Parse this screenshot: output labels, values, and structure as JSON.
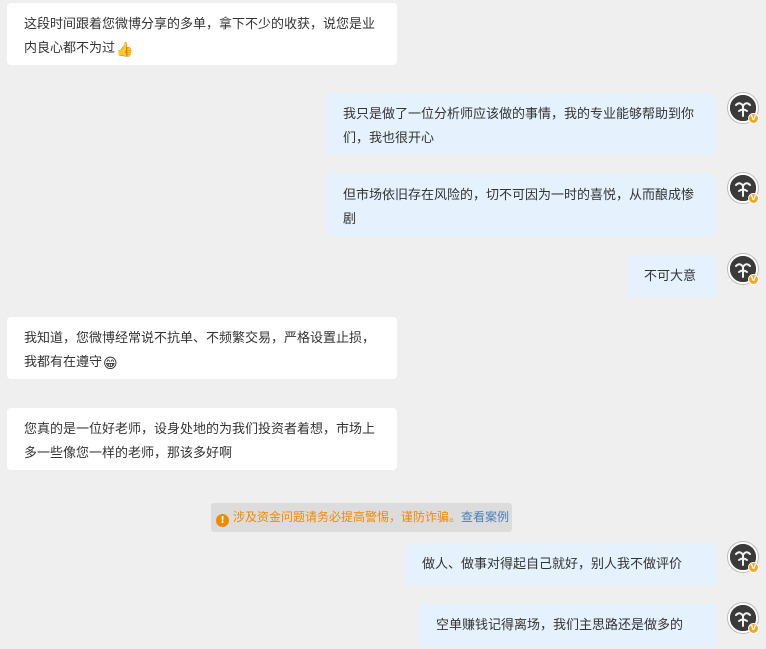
{
  "messages": [
    {
      "side": "incoming",
      "text": "这段时间跟着您微博分享的多单，拿下不少的收获，说您是业内良心都不为过",
      "emoji": "👍",
      "emoji_name": "thumbs-up-icon"
    },
    {
      "side": "outgoing",
      "text": "我只是做了一位分析师应该做的事情，我的专业能够帮助到你们，我也很开心"
    },
    {
      "side": "outgoing",
      "text": "但市场依旧存在风险的，切不可因为一时的喜悦，从而酿成惨剧"
    },
    {
      "side": "outgoing",
      "text": "不可大意"
    },
    {
      "side": "incoming",
      "text": "我知道，您微博经常说不抗单、不频繁交易，严格设置止损，我都有在遵守",
      "emoji": "😁",
      "emoji_name": "grin-icon"
    },
    {
      "side": "incoming",
      "text": "您真的是一位好老师，设身处地的为我们投资者着想，市场上多一些像您一样的老师，那该多好啊"
    },
    {
      "side": "outgoing",
      "text": "做人、做事对得起自己就好，别人我不做评价"
    },
    {
      "side": "outgoing",
      "text": "空单赚钱记得离场，我们主思路还是做多的"
    }
  ],
  "notice": {
    "icon": "info-icon",
    "text": "涉及资金问题请务必提高警惕，谨防诈骗。",
    "link": "查看案例"
  },
  "avatar": {
    "icon": "user-avatar",
    "badge": "V"
  },
  "colors": {
    "background": "#efefef",
    "incoming_bubble": "#ffffff",
    "outgoing_bubble": "#e5f1fc",
    "notice_text": "#f08a00",
    "notice_link": "#4a7fb5"
  }
}
